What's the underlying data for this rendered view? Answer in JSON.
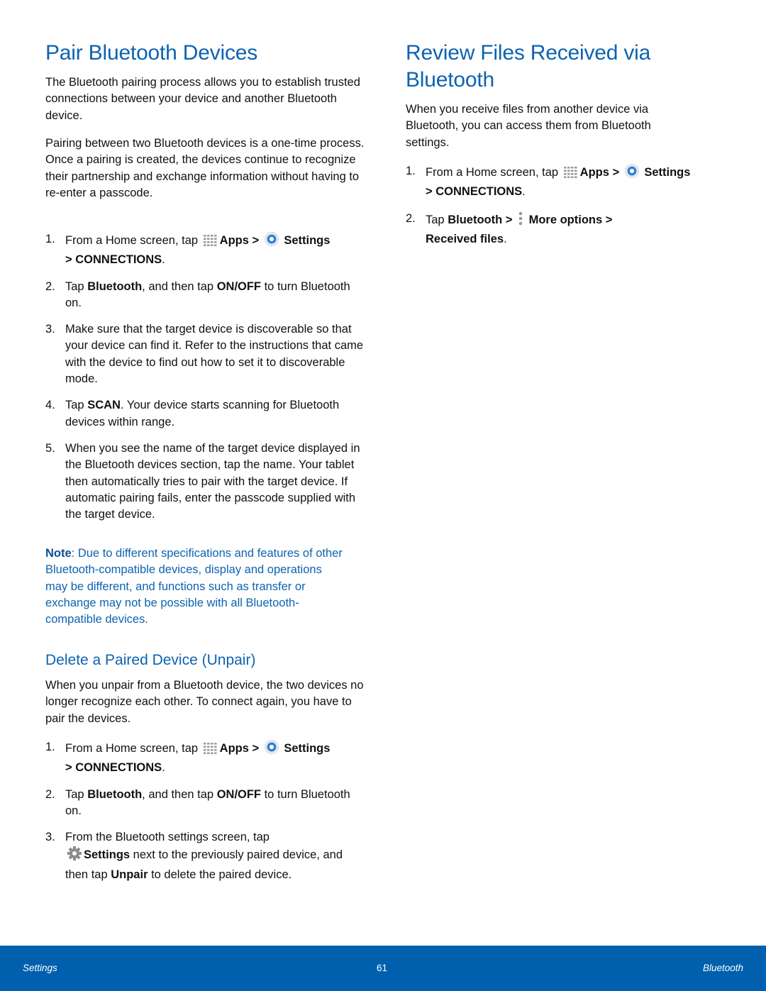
{
  "left": {
    "title": "Pair Bluetooth Devices",
    "intro1": "The Bluetooth pairing process allows you to establish trusted connections between your device and another Bluetooth device.",
    "intro2": "Pairing between two Bluetooth devices is a one-time process. Once a pairing is created, the devices continue to recognize their partnership and exchange information without having to re-enter a passcode.",
    "steps": [
      {
        "num": "1.",
        "pre": "From a Home screen, tap ",
        "apps": "Apps",
        "sep1": " > ",
        "settings": "Settings",
        "sep2": " > ",
        "connections": "CONNECTIONS",
        "end": "."
      },
      {
        "num": "2.",
        "pre": "Tap ",
        "b1": "Bluetooth",
        "mid": ", and then tap ",
        "b2": "ON/OFF",
        "end": " to turn Bluetooth on."
      },
      {
        "num": "3.",
        "text": "Make sure that the target device is discoverable so that your device can find it. Refer to the instructions that came with the device to find out how to set it to discoverable mode."
      },
      {
        "num": "4.",
        "pre": "Tap ",
        "b1": "SCAN",
        "end": ". Your device starts scanning for Bluetooth devices within range."
      },
      {
        "num": "5.",
        "text": "When you see the name of the target device displayed in the Bluetooth devices section, tap the name. Your tablet then automatically tries to pair with the target device. If automatic pairing fails, enter the passcode supplied with the target device."
      }
    ],
    "note_label": "Note",
    "note_text": ": Due to different specifications and features of other Bluetooth-compatible devices, display and operations may be different, and functions such as transfer or exchange may not be possible with all Bluetooth-compatible devices.",
    "subtitle": "Delete a Paired Device (Unpair)",
    "unpair_intro": "When you unpair from a Bluetooth device, the two devices no longer recognize each other. To connect again, you have to pair the devices.",
    "unpair_steps": [
      {
        "num": "1.",
        "pre": "From a Home screen, tap ",
        "apps": "Apps",
        "sep1": " > ",
        "settings": "Settings",
        "sep2": " > ",
        "connections": "CONNECTIONS",
        "end": "."
      },
      {
        "num": "2.",
        "pre": "Tap ",
        "b1": "Bluetooth",
        "mid": ", and then tap ",
        "b2": "ON/OFF",
        "end": " to turn Bluetooth on."
      },
      {
        "num": "3.",
        "pre": "From the Bluetooth settings screen, tap ",
        "b1": "Settings",
        "mid": " next to the previously paired device, and then tap ",
        "b2": "Unpair",
        "end": " to delete the paired device."
      }
    ]
  },
  "right": {
    "title": "Review Files Received via Bluetooth",
    "intro": "When you receive files from another device via Bluetooth, you can access them from Bluetooth settings.",
    "steps": [
      {
        "num": "1.",
        "pre": "From a Home screen, tap ",
        "apps": "Apps",
        "sep1": " > ",
        "settings": "Settings",
        "sep2": " > ",
        "connections": "CONNECTIONS",
        "end": "."
      },
      {
        "num": "2.",
        "pre": "Tap ",
        "b1": "Bluetooth",
        "sep1": " > ",
        "b2": "More options",
        "sep2": " > ",
        "b3": "Received files",
        "end": "."
      }
    ]
  },
  "footer": {
    "left": "Settings",
    "page": "61",
    "right": "Bluetooth"
  },
  "icons": {
    "apps": "apps-grid-icon",
    "settings": "settings-gear-icon",
    "more": "more-options-icon",
    "gear_gray": "gear-icon"
  },
  "colors": {
    "heading": "#0d63b0",
    "footer_bg": "#0060ad",
    "body_text": "#111111"
  }
}
